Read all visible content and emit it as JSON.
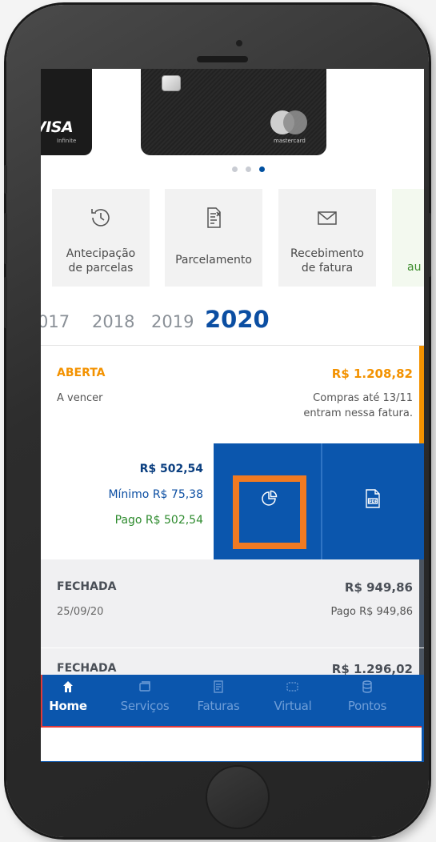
{
  "cards": {
    "visa": {
      "brand": "VISA",
      "subtitle": "Infinite"
    },
    "mastercard": {
      "brand": "mastercard"
    },
    "carousel": {
      "total": 3,
      "active": 3
    }
  },
  "quick_actions": [
    {
      "label_line1": "Antecipação",
      "label_line2": "de parcelas",
      "icon": "history-clock-icon"
    },
    {
      "label_line1": "Parcelamento",
      "label_line2": "",
      "icon": "installment-document-icon"
    },
    {
      "label_line1": "Recebimento",
      "label_line2": "de fatura",
      "icon": "envelope-icon"
    },
    {
      "label_line1": "au",
      "label_line2": "",
      "icon": ""
    }
  ],
  "years": [
    "017",
    "2018",
    "2019",
    "2020"
  ],
  "selected_year": "2020",
  "open_invoice": {
    "status": "ABERTA",
    "total": "R$ 1.208,82",
    "subtitle": "A vencer",
    "note_line1": "Compras até 13/11",
    "note_line2": "entram nessa fatura.",
    "amount": "R$ 502,54",
    "minimum": "Mínimo R$ 75,38",
    "paid": "Pago R$ 502,54",
    "actions": [
      "pie-chart-icon",
      "pdf-icon"
    ]
  },
  "closed_invoices": [
    {
      "status": "FECHADA",
      "total": "R$ 949,86",
      "date": "25/09/20",
      "paid": "Pago R$ 949,86"
    },
    {
      "status": "FECHADA",
      "total": "R$ 1.296,02"
    }
  ],
  "bottom_nav": [
    {
      "label": "Home",
      "icon": "home-icon",
      "active": true
    },
    {
      "label": "Serviços",
      "icon": "services-icon",
      "active": false
    },
    {
      "label": "Faturas",
      "icon": "invoices-icon",
      "active": false
    },
    {
      "label": "Virtual",
      "icon": "virtual-card-icon",
      "active": false
    },
    {
      "label": "Pontos",
      "icon": "points-icon",
      "active": false
    }
  ],
  "colors": {
    "primary_blue": "#0b56ad",
    "orange": "#f39200",
    "green": "#2e8b2e",
    "highlight": "#f07a22"
  }
}
